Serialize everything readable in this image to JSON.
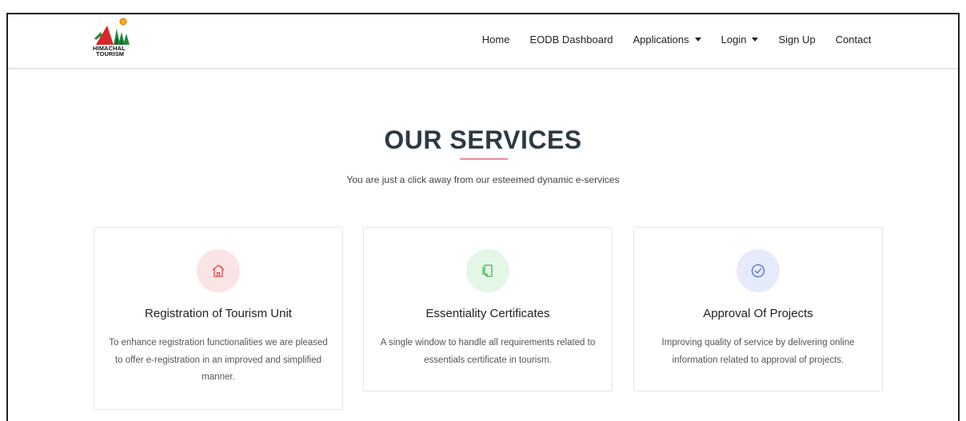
{
  "brand": {
    "logo_text_line1": "HIMACHAL",
    "logo_text_line2": "TOURISM"
  },
  "nav": {
    "home": "Home",
    "eodb": "EODB Dashboard",
    "applications": "Applications",
    "login": "Login",
    "signup": "Sign Up",
    "contact": "Contact"
  },
  "section": {
    "title": "OUR SERVICES",
    "subtitle": "You are just a click away from our esteemed dynamic e-services"
  },
  "cards": [
    {
      "icon": "home-icon",
      "title": "Registration of Tourism Unit",
      "text": "To enhance registration functionalities we are pleased to offer e-registration in an improved and simplified manner.",
      "color": "#e5484d",
      "bg": "#fbe4e5"
    },
    {
      "icon": "document-icon",
      "title": "Essentiality Certificates",
      "text": "A single window to handle all requirements related to essentials certificate in tourism.",
      "color": "#3fb950",
      "bg": "#e4f6e6"
    },
    {
      "icon": "check-circle-icon",
      "title": "Approval Of Projects",
      "text": "Improving quality of service by delivering online information related to approval of projects.",
      "color": "#4a67d8",
      "bg": "#e6ebfb"
    }
  ],
  "colors": {
    "accent_underline": "#e98b97",
    "title": "#2d3a45"
  }
}
